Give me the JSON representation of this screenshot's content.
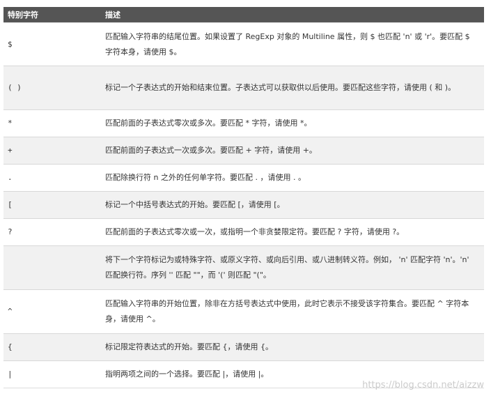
{
  "table": {
    "headers": [
      "特别字符",
      "描述"
    ],
    "rows": [
      {
        "char": "$",
        "desc": "匹配输入字符串的结尾位置。如果设置了 RegExp 对象的 Multiline 属性，则 $ 也匹配 'n' 或 'r'。要匹配 $ 字符本身，请使用 $。"
      },
      {
        "char": "( )",
        "desc": "标记一个子表达式的开始和结束位置。子表达式可以获取供以后使用。要匹配这些字符，请使用 ( 和 )。"
      },
      {
        "char": "*",
        "desc": "匹配前面的子表达式零次或多次。要匹配 * 字符，请使用 *。"
      },
      {
        "char": "+",
        "desc": "匹配前面的子表达式一次或多次。要匹配 + 字符，请使用 +。"
      },
      {
        "char": ".",
        "desc": "匹配除换行符 n 之外的任何单字符。要匹配 . ，请使用 . 。"
      },
      {
        "char": "[",
        "desc": "标记一个中括号表达式的开始。要匹配 [，请使用 [。"
      },
      {
        "char": "?",
        "desc": "匹配前面的子表达式零次或一次，或指明一个非贪婪限定符。要匹配 ? 字符，请使用 ?。"
      },
      {
        "char": "",
        "desc": "将下一个字符标记为或特殊字符、或原义字符、或向后引用、或八进制转义符。例如， 'n' 匹配字符 'n'。'n' 匹配换行符。序列 '' 匹配 \"\"，而 '(' 则匹配 \"(\"。"
      },
      {
        "char": "^",
        "desc": "匹配输入字符串的开始位置，除非在方括号表达式中使用，此时它表示不接受该字符集合。要匹配 ^ 字符本身，请使用 ^。"
      },
      {
        "char": "{",
        "desc": "标记限定符表达式的开始。要匹配 {，请使用 {。"
      },
      {
        "char": "|",
        "desc": "指明两项之间的一个选择。要匹配 |，请使用 |。"
      }
    ]
  },
  "watermark": "https://blog.csdn.net/aizzw"
}
